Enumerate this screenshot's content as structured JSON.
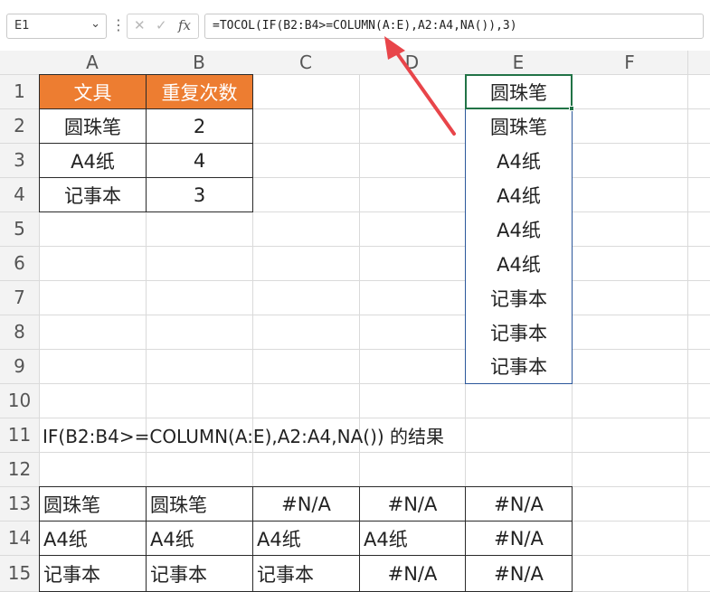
{
  "formula_bar": {
    "name_box": "E1",
    "name_box_caret": "⌄",
    "options": "⋮",
    "cancel_icon": "✕",
    "confirm_icon": "✓",
    "fx_label": "fx",
    "formula": "=TOCOL(IF(B2:B4>=COLUMN(A:E),A2:A4,NA()),3)"
  },
  "columns": [
    "A",
    "B",
    "C",
    "D",
    "E",
    "F"
  ],
  "rows": [
    "1",
    "2",
    "3",
    "4",
    "5",
    "6",
    "7",
    "8",
    "9",
    "10",
    "11",
    "12",
    "13",
    "14",
    "15"
  ],
  "source_table": {
    "headers": [
      "文具",
      "重复次数"
    ],
    "rows": [
      {
        "item": "圆珠笔",
        "count": "2"
      },
      {
        "item": "A4纸",
        "count": "4"
      },
      {
        "item": "记事本",
        "count": "3"
      }
    ]
  },
  "result_column": [
    "圆珠笔",
    "圆珠笔",
    "A4纸",
    "A4纸",
    "A4纸",
    "A4纸",
    "记事本",
    "记事本",
    "记事本"
  ],
  "note": "IF(B2:B4>=COLUMN(A:E),A2:A4,NA())   的结果",
  "if_result": [
    [
      "圆珠笔",
      "圆珠笔",
      "#N/A",
      "#N/A",
      "#N/A"
    ],
    [
      "A4纸",
      "A4纸",
      "A4纸",
      "A4纸",
      "#N/A"
    ],
    [
      "记事本",
      "记事本",
      "记事本",
      "#N/A",
      "#N/A"
    ]
  ],
  "colors": {
    "header_fill": "#ed7d31",
    "selection": "#217346",
    "arrow": "#e8454a"
  }
}
